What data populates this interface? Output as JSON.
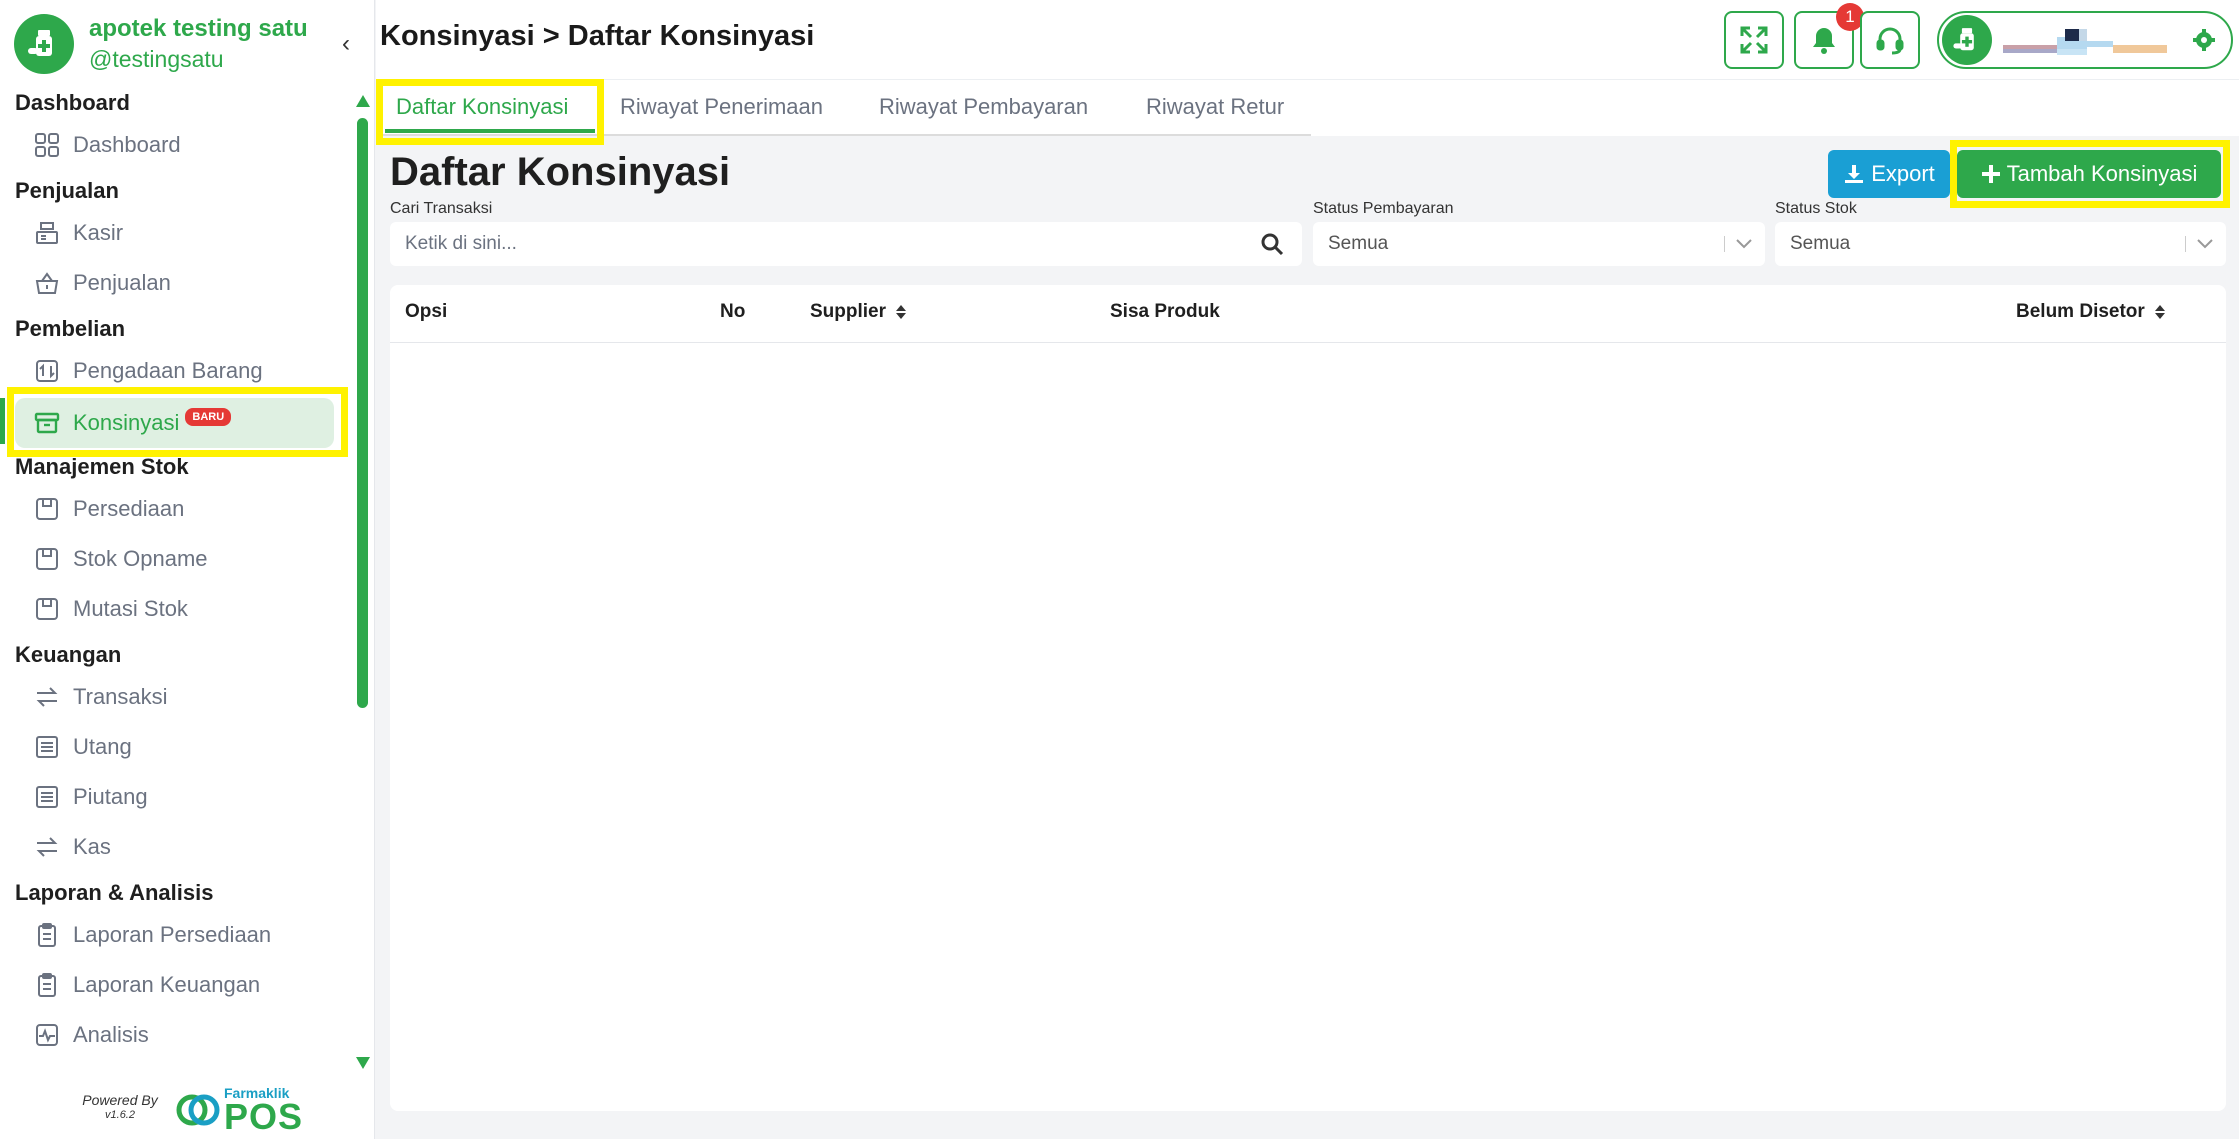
{
  "brand": {
    "name": "apotek testing satu",
    "handle": "@testingsatu"
  },
  "sidebar": {
    "sections": [
      {
        "title": "Dashboard",
        "items": [
          {
            "label": "Dashboard",
            "icon": "grid-icon"
          }
        ]
      },
      {
        "title": "Penjualan",
        "items": [
          {
            "label": "Kasir",
            "icon": "cash-register-icon"
          },
          {
            "label": "Penjualan",
            "icon": "basket-icon"
          }
        ]
      },
      {
        "title": "Pembelian",
        "items": [
          {
            "label": "Pengadaan Barang",
            "icon": "procurement-icon"
          },
          {
            "label": "Konsinyasi",
            "icon": "archive-box-icon",
            "badge": "BARU",
            "active": true
          }
        ]
      },
      {
        "title": "Manajemen Stok",
        "items": [
          {
            "label": "Persediaan",
            "icon": "box-icon"
          },
          {
            "label": "Stok Opname",
            "icon": "box-icon"
          },
          {
            "label": "Mutasi Stok",
            "icon": "box-icon"
          }
        ]
      },
      {
        "title": "Keuangan",
        "items": [
          {
            "label": "Transaksi",
            "icon": "transfer-icon"
          },
          {
            "label": "Utang",
            "icon": "ledger-icon"
          },
          {
            "label": "Piutang",
            "icon": "ledger-icon"
          },
          {
            "label": "Kas",
            "icon": "transfer-icon"
          }
        ]
      },
      {
        "title": "Laporan & Analisis",
        "items": [
          {
            "label": "Laporan Persediaan",
            "icon": "clipboard-icon"
          },
          {
            "label": "Laporan Keuangan",
            "icon": "clipboard-icon"
          },
          {
            "label": "Analisis",
            "icon": "analytics-icon"
          }
        ]
      }
    ],
    "powered_by": "Powered By",
    "version": "v1.6.2",
    "pos_brand_small": "Farmaklik",
    "pos_brand_big": "POS"
  },
  "header": {
    "breadcrumb": "Konsinyasi > Daftar Konsinyasi",
    "notification_count": "1"
  },
  "tabs": [
    {
      "label": "Daftar Konsinyasi",
      "active": true
    },
    {
      "label": "Riwayat Penerimaan"
    },
    {
      "label": "Riwayat Pembayaran"
    },
    {
      "label": "Riwayat Retur"
    }
  ],
  "main": {
    "title": "Daftar Konsinyasi",
    "export_label": "Export",
    "add_label": "Tambah Konsinyasi",
    "search": {
      "label": "Cari Transaksi",
      "placeholder": "Ketik di sini..."
    },
    "status_pembayaran": {
      "label": "Status Pembayaran",
      "value": "Semua"
    },
    "status_stok": {
      "label": "Status Stok",
      "value": "Semua"
    },
    "table": {
      "columns": [
        "Opsi",
        "No",
        "Supplier",
        "Sisa Produk",
        "Belum Disetor"
      ],
      "rows": []
    }
  },
  "colors": {
    "accent": "#2ea84b",
    "export": "#1a9fd4",
    "highlight": "#fff200",
    "badge": "#e53935"
  }
}
